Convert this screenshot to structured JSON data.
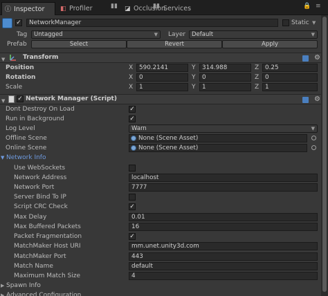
{
  "tabs": [
    {
      "label": "Inspector",
      "icon": "info-icon",
      "active": true
    },
    {
      "label": "Profiler",
      "icon": "profiler-icon",
      "active": false
    },
    {
      "label": "Occlusion",
      "icon": "occlusion-icon",
      "active": false
    },
    {
      "label": "Services",
      "icon": "cloud-icon",
      "active": false
    }
  ],
  "gameobject": {
    "name": "NetworkManager",
    "static_label": "Static",
    "tag_label": "Tag",
    "tag_value": "Untagged",
    "layer_label": "Layer",
    "layer_value": "Default",
    "prefab_label": "Prefab",
    "prefab_select": "Select",
    "prefab_revert": "Revert",
    "prefab_apply": "Apply"
  },
  "transform": {
    "title": "Transform",
    "position_label": "Position",
    "rotation_label": "Rotation",
    "scale_label": "Scale",
    "axis_x": "X",
    "axis_y": "Y",
    "axis_z": "Z",
    "position": {
      "x": "590.2141",
      "y": "314.988",
      "z": "0.25"
    },
    "rotation": {
      "x": "0",
      "y": "0",
      "z": "0"
    },
    "scale": {
      "x": "1",
      "y": "1",
      "z": "1"
    }
  },
  "network_manager": {
    "title": "Network Manager (Script)",
    "dont_destroy_label": "Dont Destroy On Load",
    "dont_destroy": true,
    "run_bg_label": "Run in Background",
    "run_bg": true,
    "log_level_label": "Log Level",
    "log_level": "Warn",
    "offline_scene_label": "Offline Scene",
    "offline_scene": "None (Scene Asset)",
    "online_scene_label": "Online Scene",
    "online_scene": "None (Scene Asset)",
    "network_info_label": "Network Info",
    "use_websockets_label": "Use WebSockets",
    "use_websockets": false,
    "network_address_label": "Network Address",
    "network_address": "localhost",
    "network_port_label": "Network Port",
    "network_port": "7777",
    "server_bind_label": "Server Bind To IP",
    "server_bind": false,
    "script_crc_label": "Script CRC Check",
    "script_crc": true,
    "max_delay_label": "Max Delay",
    "max_delay": "0.01",
    "max_buffered_label": "Max Buffered Packets",
    "max_buffered": "16",
    "packet_frag_label": "Packet Fragmentation",
    "packet_frag": true,
    "mm_host_label": "MatchMaker Host URI",
    "mm_host": "mm.unet.unity3d.com",
    "mm_port_label": "MatchMaker Port",
    "mm_port": "443",
    "match_name_label": "Match Name",
    "match_name": "default",
    "max_match_size_label": "Maximum Match Size",
    "max_match_size": "4",
    "spawn_info_label": "Spawn Info",
    "advanced_config_label": "Advanced Configuration"
  },
  "colors": {
    "background": "#383838",
    "tabbar": "#1f1f1f",
    "field": "#2a2a2a",
    "link_blue": "#6f9be0"
  }
}
